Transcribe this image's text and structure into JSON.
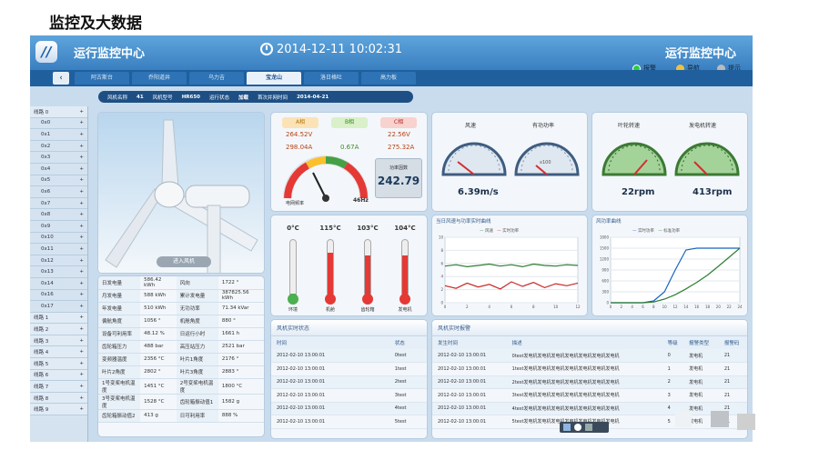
{
  "slide": {
    "title": "监控及大数据"
  },
  "header": {
    "logo": "//",
    "title": "运行监控中心",
    "datetime": "2014-12-11 10:02:31",
    "title_right": "运行监控中心",
    "alarm": "报警",
    "nav": "导航",
    "hint": "提示"
  },
  "tabs": [
    "阿古斯台",
    "乔阳道井",
    "乌力吉",
    "宝龙山",
    "洛日格吐",
    "高力板"
  ],
  "info": {
    "fan_name_label": "风机名称",
    "fan_name": "41",
    "fan_model_label": "风机型号",
    "fan_model": "HR650",
    "status_label": "运行状态",
    "status": "加载",
    "first_run_label": "首次并网时间",
    "first_run": "2014-04-21"
  },
  "sidebar": [
    {
      "label": "线路 0",
      "sign": "+",
      "group": true
    },
    {
      "label": "0x0",
      "sign": "+"
    },
    {
      "label": "0x1",
      "sign": "+"
    },
    {
      "label": "0x2",
      "sign": "+"
    },
    {
      "label": "0x3",
      "sign": "+"
    },
    {
      "label": "0x4",
      "sign": "+"
    },
    {
      "label": "0x5",
      "sign": "+"
    },
    {
      "label": "0x6",
      "sign": "+"
    },
    {
      "label": "0x7",
      "sign": "+"
    },
    {
      "label": "0x8",
      "sign": "+"
    },
    {
      "label": "0x9",
      "sign": "+"
    },
    {
      "label": "0x10",
      "sign": "+"
    },
    {
      "label": "0x11",
      "sign": "+"
    },
    {
      "label": "0x12",
      "sign": "+"
    },
    {
      "label": "0x13",
      "sign": "+"
    },
    {
      "label": "0x14",
      "sign": "+"
    },
    {
      "label": "0x16",
      "sign": "+"
    },
    {
      "label": "0x17",
      "sign": "+"
    },
    {
      "label": "线路 1",
      "sign": "+",
      "group": true
    },
    {
      "label": "线路 2",
      "sign": "+",
      "group": true
    },
    {
      "label": "线路 3",
      "sign": "+",
      "group": true
    },
    {
      "label": "线路 4",
      "sign": "+",
      "group": true
    },
    {
      "label": "线路 5",
      "sign": "+",
      "group": true
    },
    {
      "label": "线路 6",
      "sign": "+",
      "group": true
    },
    {
      "label": "线路 7",
      "sign": "+",
      "group": true
    },
    {
      "label": "线路 8",
      "sign": "+",
      "group": true
    },
    {
      "label": "线路 9",
      "sign": "+",
      "group": true
    }
  ],
  "turbine": {
    "enter_button": "进入风机"
  },
  "stats": [
    [
      "日发电量",
      "586.42 kWh",
      "风向",
      "1722 °"
    ],
    [
      "月发电量",
      "588 kWh",
      "累计发电量",
      "387825.56 kWh"
    ],
    [
      "年发电量",
      "510 kWh",
      "无功功率",
      "71.34 kVar"
    ],
    [
      "偏航角度",
      "1056 °",
      "机舱角度",
      "880 °"
    ],
    [
      "设备可利用率",
      "48.12 %",
      "日运行小时",
      "1661 h"
    ],
    [
      "齿轮箱压力",
      "488 bar",
      "高压站压力",
      "2521 bar"
    ],
    [
      "变频器温度",
      "2356 °C",
      "叶片1角度",
      "2176 °"
    ],
    [
      "叶片2角度",
      "2802 °",
      "叶片3角度",
      "2883 °"
    ],
    [
      "1号变桨电机温度",
      "1451 °C",
      "2号变桨电机温度",
      "1800 °C"
    ],
    [
      "3号变桨电机温度",
      "1528 °C",
      "齿轮箱振动值1",
      "1582 g"
    ],
    [
      "齿轮箱振动值2",
      "413 g",
      "日可利用率",
      "888 %"
    ]
  ],
  "phases": {
    "a_label": "A相",
    "b_label": "B相",
    "c_label": "C相",
    "a_v": "264.52V",
    "b_v": "",
    "c_v": "22.56V",
    "a_a": "298.04A",
    "b_a": "0.67A",
    "c_a": "275.32A"
  },
  "grid": {
    "freq_label": "电网频率",
    "unit": "Hz",
    "freq": "46Hz",
    "power_label": "功率因数",
    "power_value": "242.79"
  },
  "gauges": {
    "wind_label": "风速",
    "wind_value": "6.39m/s",
    "active_label": "有功功率",
    "active_unit": "x100",
    "rotor_label": "叶轮转速",
    "rotor_value": "22rpm",
    "gen_label": "发电机转速",
    "gen_value": "413rpm"
  },
  "temps": [
    {
      "value": "0°C",
      "label": "环境",
      "fill": 0.05,
      "color": "#4caf50"
    },
    {
      "value": "115°C",
      "label": "机舱",
      "fill": 0.78,
      "color": "#e53935"
    },
    {
      "value": "103°C",
      "label": "齿轮箱",
      "fill": 0.72,
      "color": "#e53935"
    },
    {
      "value": "104°C",
      "label": "发电机",
      "fill": 0.72,
      "color": "#e53935"
    }
  ],
  "wind_chart": {
    "title": "当日风速与功率实时曲线",
    "legend_wind": "风速",
    "legend_power": "实时功率"
  },
  "power_curve": {
    "title": "风功率曲线",
    "legend_real": "实时功率",
    "legend_standard": "标准功率"
  },
  "chart_data": [
    {
      "type": "line",
      "title": "当日风速与功率实时曲线",
      "x": [
        0,
        2,
        4,
        6,
        8,
        10,
        12
      ],
      "xlim": [
        0,
        12
      ],
      "ylim": [
        0,
        10
      ],
      "y2lim": [
        0,
        8
      ],
      "series": [
        {
          "name": "风速",
          "values": [
            5.6,
            5.8,
            5.5,
            5.7,
            5.9,
            5.6,
            5.8,
            5.5,
            5.9,
            5.7,
            5.6,
            5.8,
            5.7
          ]
        },
        {
          "name": "实时功率",
          "values": [
            2.6,
            2.2,
            3.0,
            2.4,
            2.8,
            2.1,
            3.2,
            2.5,
            3.1,
            2.3,
            2.9,
            2.6,
            3.0
          ]
        }
      ]
    },
    {
      "type": "line",
      "title": "风功率曲线",
      "x": [
        0,
        2,
        4,
        6,
        8,
        10,
        12,
        14,
        16,
        18,
        20,
        22,
        24
      ],
      "xlim": [
        0,
        24
      ],
      "ylim": [
        0,
        1800
      ],
      "series": [
        {
          "name": "实时功率",
          "values": [
            0,
            0,
            0,
            0,
            50,
            300,
            900,
            1450,
            1500,
            1500,
            1500,
            1500,
            1500
          ]
        },
        {
          "name": "标准功率",
          "values": [
            0,
            0,
            0,
            0,
            20,
            100,
            220,
            380,
            560,
            760,
            1000,
            1250,
            1500
          ]
        }
      ]
    }
  ],
  "fan_status": {
    "title": "风机实时状态",
    "col_time": "时间",
    "col_status": "状态",
    "rows": [
      [
        "2012-02-10 13:00:01",
        "0test"
      ],
      [
        "2012-02-10 13:00:01",
        "1test"
      ],
      [
        "2012-02-10 13:00:01",
        "2test"
      ],
      [
        "2012-02-10 13:00:01",
        "3test"
      ],
      [
        "2012-02-10 13:00:01",
        "4test"
      ],
      [
        "2012-02-10 13:00:01",
        "5test"
      ]
    ]
  },
  "fan_alarm": {
    "title": "风机实时报警",
    "col_time": "发生时间",
    "col_desc": "描述",
    "col_level": "等级",
    "col_type": "报警类型",
    "col_code": "报警码",
    "rows": [
      [
        "2012-02-10 13:00:01",
        "0test发电机发电机发电机发电机发电机发电机发电机",
        "0",
        "发电机",
        "21"
      ],
      [
        "2012-02-10 13:00:01",
        "1test发电机发电机发电机发电机发电机发电机发电机",
        "1",
        "发电机",
        "21"
      ],
      [
        "2012-02-10 13:00:01",
        "2test发电机发电机发电机发电机发电机发电机发电机",
        "2",
        "发电机",
        "21"
      ],
      [
        "2012-02-10 13:00:01",
        "3test发电机发电机发电机发电机发电机发电机发电机",
        "3",
        "发电机",
        "21"
      ],
      [
        "2012-02-10 13:00:01",
        "4test发电机发电机发电机发电机发电机发电机发电机",
        "4",
        "发电机",
        "21"
      ],
      [
        "2012-02-10 13:00:01",
        "5test发电机发电机发电机发电机发电机发电机发电机",
        "5",
        "发电机",
        "21"
      ]
    ]
  }
}
